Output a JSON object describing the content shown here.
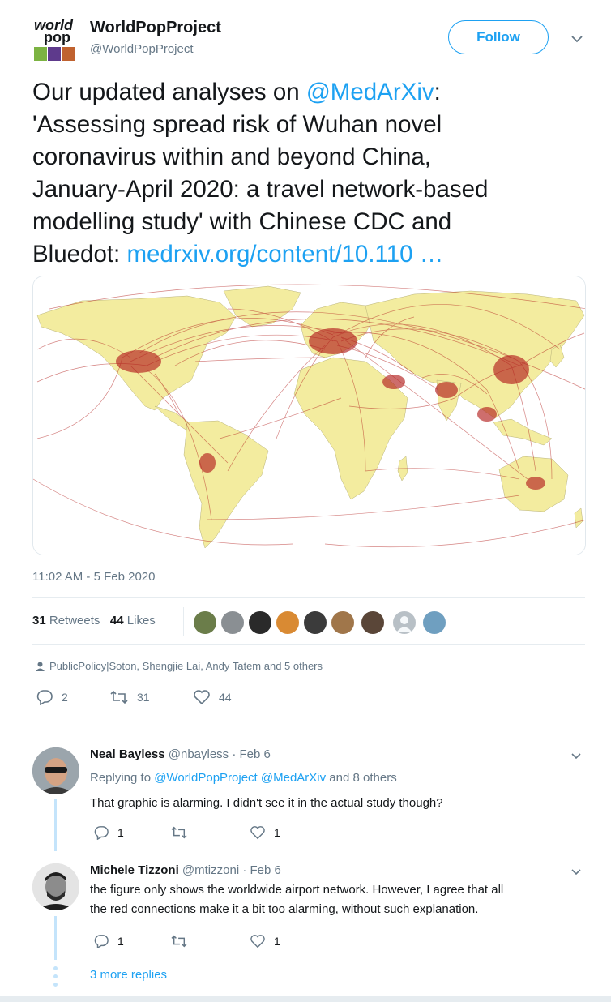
{
  "author": {
    "name": "WorldPopProject",
    "handle": "@WorldPopProject",
    "logo_text_1": "world",
    "logo_text_2": "pop",
    "follow_label": "Follow"
  },
  "tweet": {
    "line1_pre": "Our updated analyses on ",
    "line1_mention": "@MedArXiv",
    "line1_post": ":",
    "line2": "'Assessing spread risk of Wuhan novel",
    "line3": "coronavirus within and beyond China,",
    "line4": "January-April 2020: a travel network-based",
    "line5": "modelling study' with Chinese CDC and",
    "line6_pre": "Bluedot: ",
    "line6_link": "medrxiv.org/content/10.110 …",
    "timestamp": "11:02 AM - 5 Feb 2020",
    "retweets_count": "31",
    "retweets_label": "Retweets",
    "likes_count": "44",
    "likes_label": "Likes",
    "liked_by": "PublicPolicy|Soton, Shengjie Lai, Andy Tatem and 5 others",
    "reply_count": "2",
    "retweet_count": "31",
    "like_count": "44"
  },
  "replies": [
    {
      "name": "Neal Bayless",
      "handle": "@nbayless",
      "date": "· Feb 6",
      "replying_prefix": "Replying to ",
      "replying_mentions": "@WorldPopProject @MedArXiv",
      "replying_suffix": " and 8 others",
      "text_line1": "That graphic is alarming. I didn't see it in the actual study though?",
      "reply_count": "1",
      "retweet_count": "",
      "like_count": "1"
    },
    {
      "name": "Michele Tizzoni",
      "handle": "@mtizzoni",
      "date": "· Feb 6",
      "text_line1": "the figure only shows the worldwide airport network. However, I agree that all",
      "text_line2": "the red connections make it a bit too alarming, without such explanation.",
      "reply_count": "1",
      "retweet_count": "",
      "like_count": "1"
    }
  ],
  "more_replies": "3 more replies",
  "colors": {
    "accent": "#1da1f2",
    "secondary_text": "#657786",
    "route_red": "#b3201e",
    "land": "#f3ec9f"
  },
  "icons": [
    "chevron-down-icon",
    "reply-icon",
    "retweet-icon",
    "heart-icon",
    "person-icon"
  ]
}
